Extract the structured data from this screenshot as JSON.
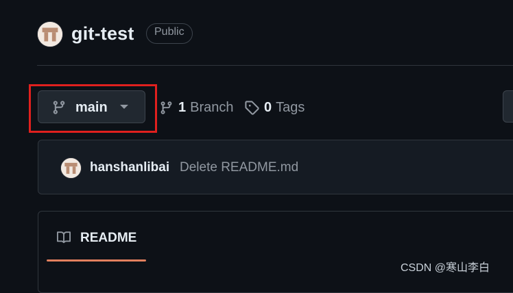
{
  "repo": {
    "name": "git-test",
    "visibility": "Public"
  },
  "branch_selector": {
    "current": "main"
  },
  "branches": {
    "count": "1",
    "label": "Branch"
  },
  "tags": {
    "count": "0",
    "label": "Tags"
  },
  "latest_commit": {
    "author": "hanshanlibai",
    "message": "Delete README.md"
  },
  "readme_tab": {
    "label": "README"
  },
  "watermark": "CSDN @寒山李白",
  "colors": {
    "background": "#0d1117",
    "accent_underline": "#e2805e",
    "highlight_box": "#e0201e"
  }
}
